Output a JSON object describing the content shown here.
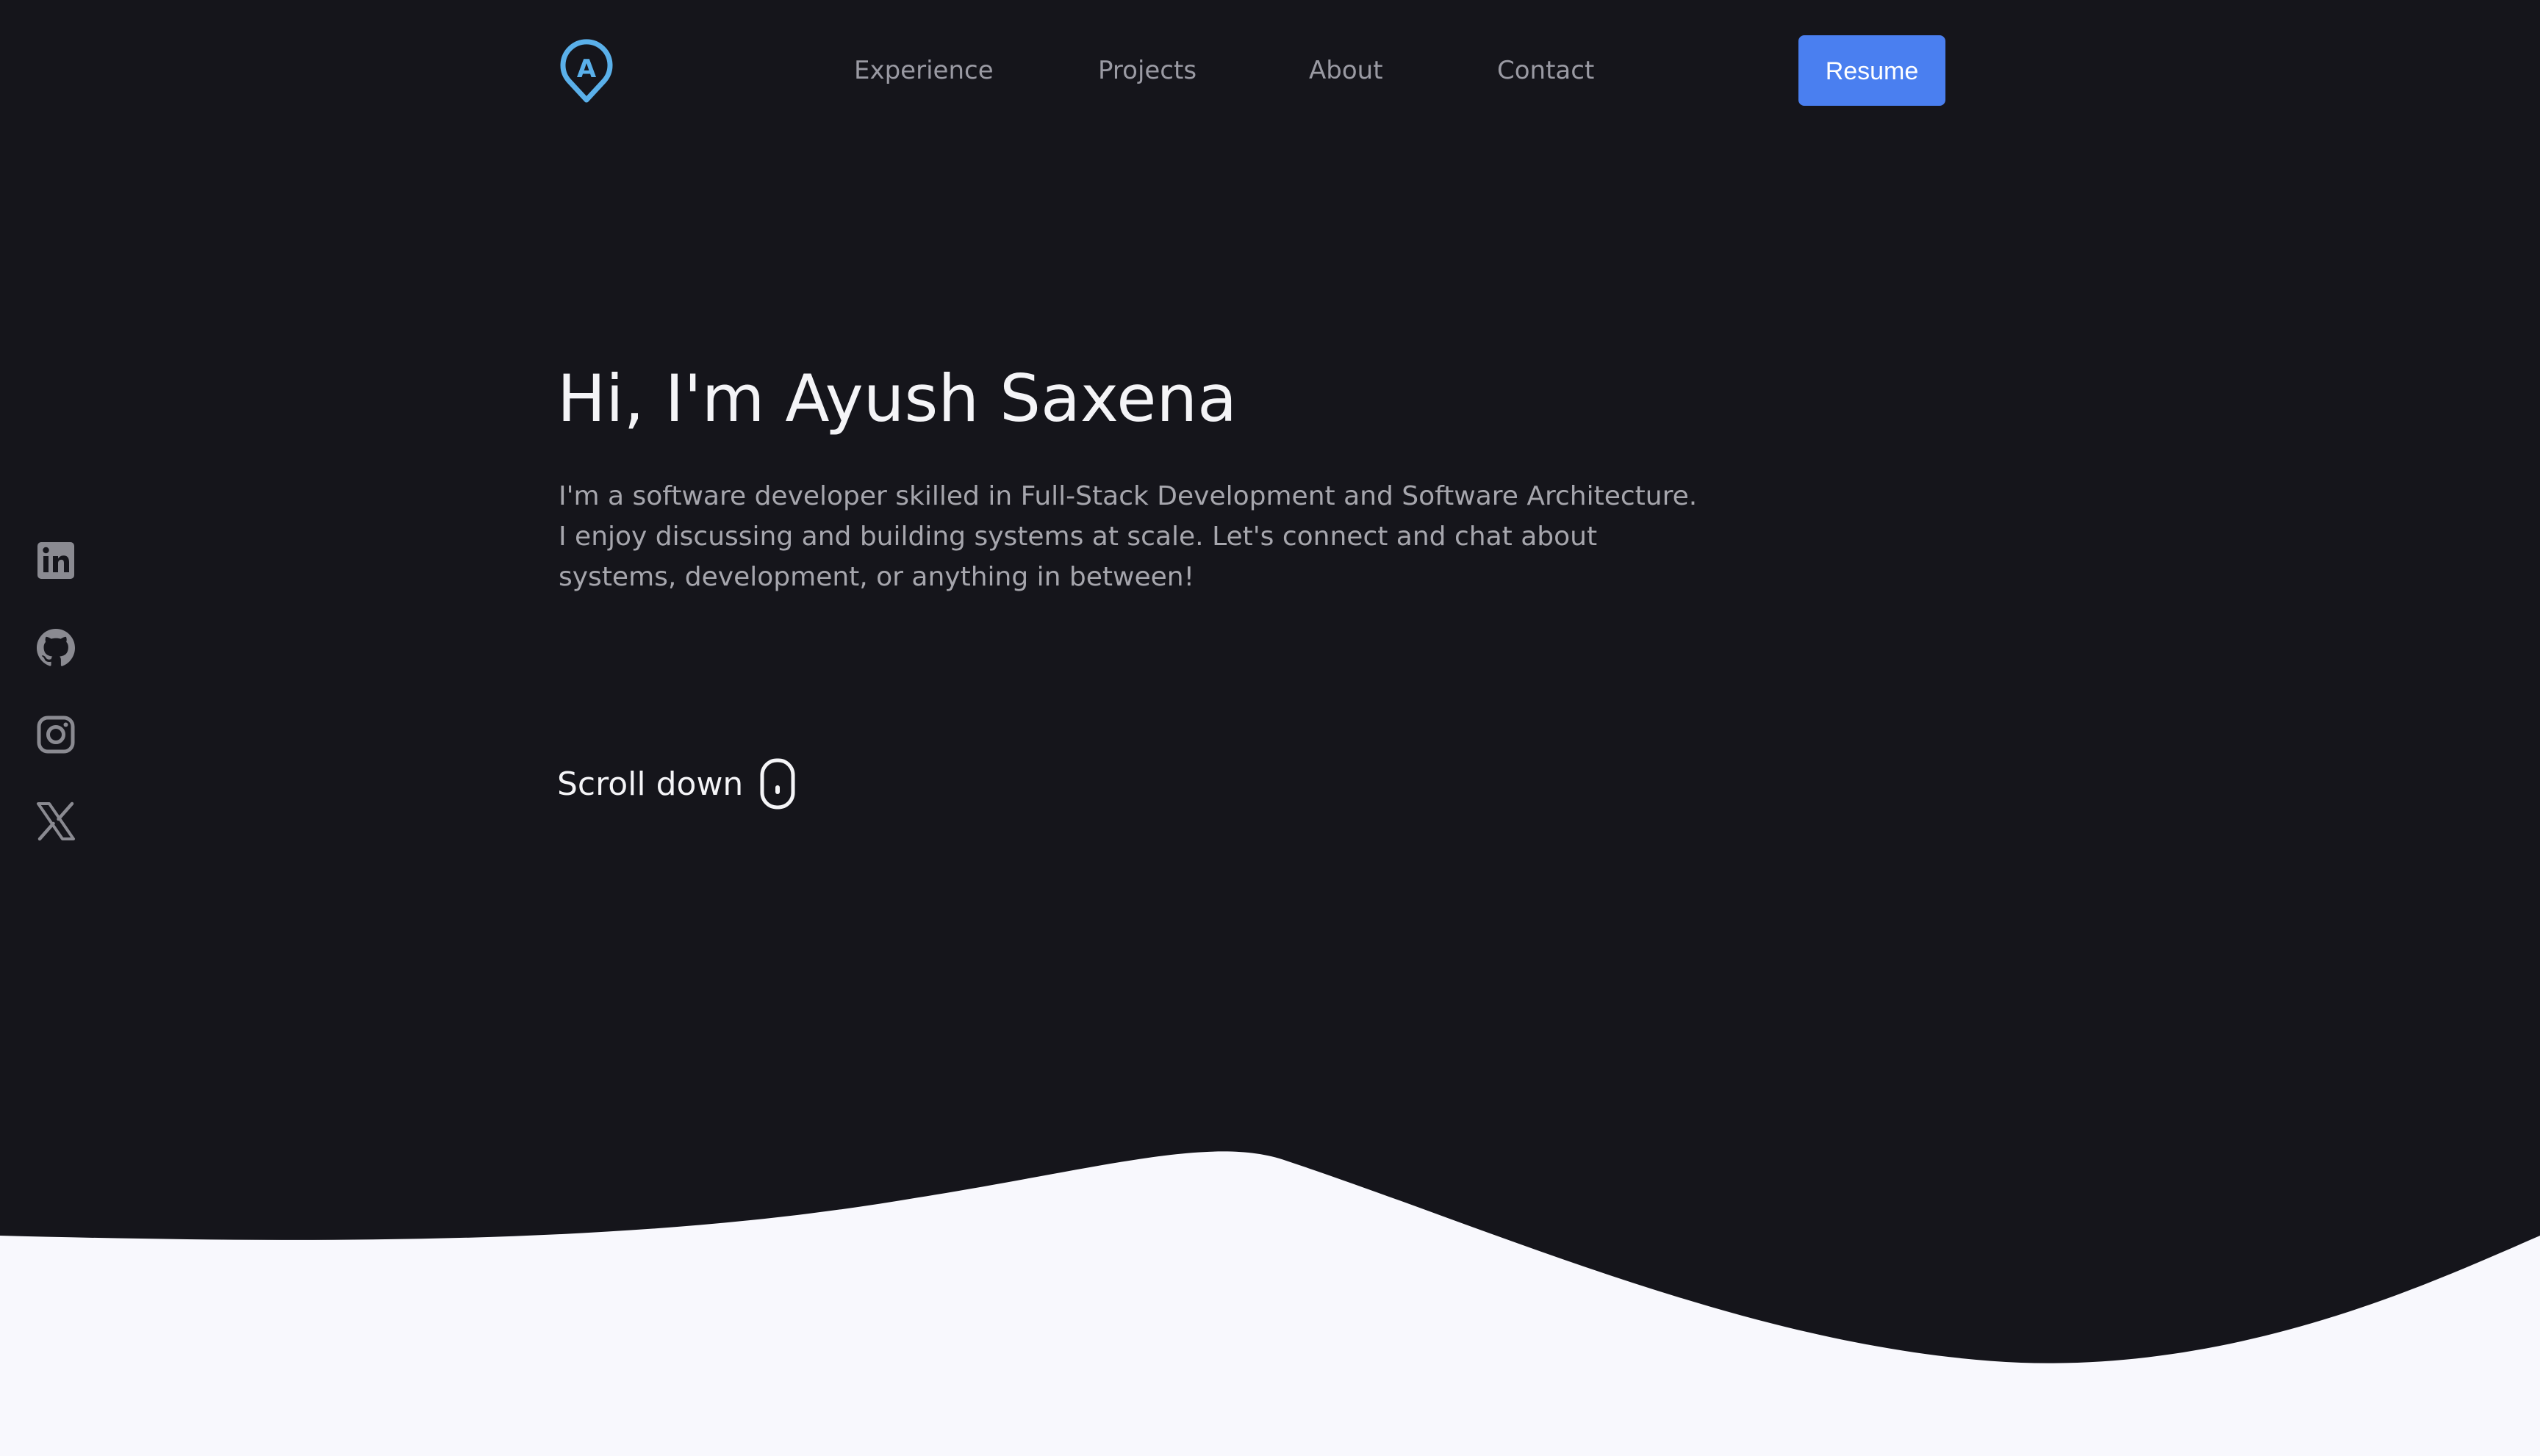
{
  "header": {
    "logo_letter": "A",
    "nav": [
      {
        "label": "Experience"
      },
      {
        "label": "Projects"
      },
      {
        "label": "About"
      },
      {
        "label": "Contact"
      }
    ],
    "resume_label": "Resume"
  },
  "social": [
    {
      "icon": "linkedin-icon"
    },
    {
      "icon": "github-icon"
    },
    {
      "icon": "instagram-icon"
    },
    {
      "icon": "x-icon"
    }
  ],
  "hero": {
    "title": "Hi, I'm Ayush Saxena",
    "description": "I'm a software developer skilled in Full-Stack Development and Software Architecture. I enjoy discussing and building systems at scale. Let's connect and chat about systems, development, or anything in between!",
    "scroll_label": "Scroll down"
  },
  "colors": {
    "background": "#15151b",
    "accent": "#4a7ff0",
    "logo": "#5ab0ea",
    "wave": "#f8f8fd"
  }
}
